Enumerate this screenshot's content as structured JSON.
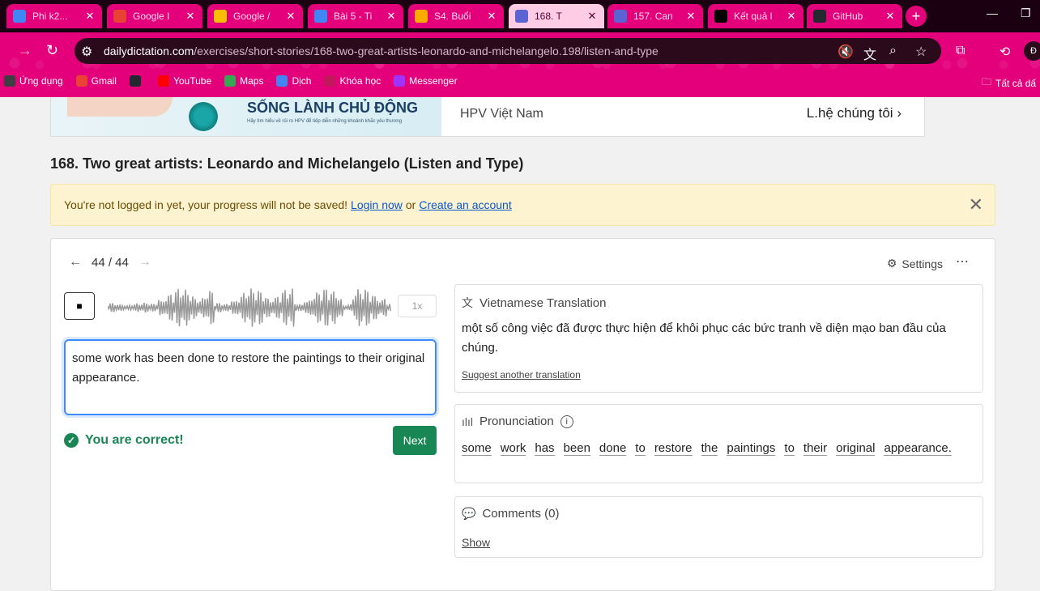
{
  "browser": {
    "tabs": [
      {
        "label": "Phi k2...",
        "color": "#4285f4",
        "active": false
      },
      {
        "label": "Google I",
        "color": "#e94235",
        "active": false
      },
      {
        "label": "Google /",
        "color": "#fbbc04",
        "active": false
      },
      {
        "label": "Bài 5 - Ti",
        "color": "#4285f4",
        "active": false
      },
      {
        "label": "S4. Buổi",
        "color": "#f9ab00",
        "active": false
      },
      {
        "label": "168. T",
        "color": "#5b63d3",
        "active": true
      },
      {
        "label": "157. Can",
        "color": "#5b63d3",
        "active": false
      },
      {
        "label": "Kết quả l",
        "color": "#000000",
        "active": false
      },
      {
        "label": "GitHub",
        "color": "#24292f",
        "active": false
      }
    ],
    "url_host": "dailydictation.com",
    "url_path": "/exercises/short-stories/168-two-great-artists-leonardo-and-michelangelo.198/listen-and-type",
    "bookmarks": [
      {
        "label": "Ứng dụng",
        "color": "#3c4043"
      },
      {
        "label": "Gmail",
        "color": "#ea4335"
      },
      {
        "label": "",
        "color": "#24292f"
      },
      {
        "label": "YouTube",
        "color": "#ff0000"
      },
      {
        "label": "Maps",
        "color": "#34a853"
      },
      {
        "label": "Dịch",
        "color": "#4285f4"
      },
      {
        "label": "Khóa học",
        "color": "#c2185b"
      },
      {
        "label": "Messenger",
        "color": "#a033ff"
      }
    ],
    "all_bookmarks": "Tất cả dấ"
  },
  "ad": {
    "headline": "SỐNG LÀNH CHỦ ĐỘNG",
    "subline": "Hãy tìm hiểu về rủi ro HPV để tiếp diễn những khoảnh khắc yêu thương",
    "brand": "HPV Việt Nam",
    "cta": "L.hệ chúng tôi"
  },
  "page": {
    "title": "168. Two great artists: Leonardo and Michelangelo (Listen and Type)"
  },
  "alert": {
    "text": "You're not logged in yet, your progress will not be saved!",
    "login_link": "Login now",
    "or": "or",
    "create_link": "Create an account"
  },
  "exercise": {
    "counter": "44 / 44",
    "settings_label": "Settings",
    "more_label": "⋯",
    "play_label": "■",
    "speed": "1x",
    "answer": "some work has been done to restore the paintings to their original appearance.",
    "status": "You are correct!",
    "next_label": "Next"
  },
  "translation": {
    "heading": "Vietnamese Translation",
    "text": "một số công việc đã được thực hiện để khôi phục các bức tranh về diện mạo ban đầu của chúng.",
    "suggest": "Suggest another translation"
  },
  "pronunciation": {
    "heading": "Pronunciation",
    "words": [
      "some",
      "work",
      "has",
      "been",
      "done",
      "to",
      "restore",
      "the",
      "paintings",
      "to",
      "their",
      "original",
      "appearance."
    ]
  },
  "comments": {
    "heading": "Comments (0)",
    "show": "Show"
  }
}
